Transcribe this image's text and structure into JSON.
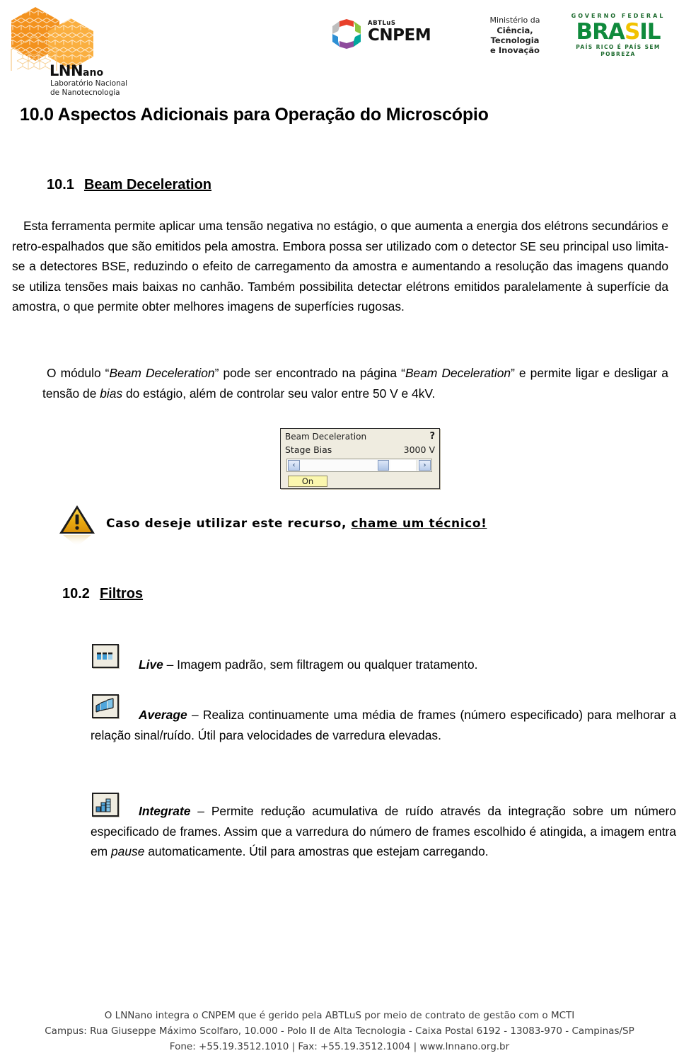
{
  "header": {
    "lnnano": {
      "word_main": "LNN",
      "word_small": "ano",
      "subtitle_line1": "Laboratório Nacional",
      "subtitle_line2": "de Nanotecnologia"
    },
    "cnpem": {
      "abtlus": "ABTLuS",
      "name": "CNPEM"
    },
    "ministerio": {
      "line1": "Ministério da",
      "line2": "Ciência, Tecnologia",
      "line3": "e Inovação"
    },
    "brasil": {
      "top": "GOVERNO FEDERAL",
      "wordmark": "BRASIL",
      "tagline": "PAÍS RICO É PAÍS SEM POBREZA"
    }
  },
  "document": {
    "title": "10.0 Aspectos Adicionais para Operação do Microscópio",
    "section_10_1": {
      "number": "10.1",
      "title": "Beam Deceleration",
      "paragraph_1_part1": "Esta ferramenta permite aplicar uma tensão negativa no estágio, o que aumenta a energia dos elétrons secundários e retro-espalhados que são emitidos pela amostra. Embora possa ser utilizado com o detector SE seu principal uso limita-se a detectores BSE, reduzindo o efeito de carregamento da amostra e aumentando a resolução das imagens quando se utiliza tensões mais baixas no canhão. Também possibilita detectar elétrons emitidos paralelamente à superfície da amostra, o que permite obter melhores imagens de superfícies rugosas.",
      "paragraph_2_a": "O módulo “",
      "paragraph_2_em1": "Beam Deceleration",
      "paragraph_2_b": "” pode ser encontrado na página “",
      "paragraph_2_em2": "Beam Deceleration",
      "paragraph_2_c": "” e permite ligar e desligar a tensão de ",
      "paragraph_2_em3": "bias",
      "paragraph_2_d": " do estágio, além de controlar seu valor entre 50 V e 4kV."
    },
    "beam_deceleration_widget": {
      "title": "Beam Deceleration",
      "help": "?",
      "field_label": "Stage Bias",
      "field_value": "3000 V",
      "left_arrow": "‹",
      "right_arrow": "›",
      "toggle_label": "On"
    },
    "warning": {
      "text_plain": "Caso deseje utilizar este recurso, ",
      "text_underlined": "chame um técnico!"
    },
    "section_10_2": {
      "number": "10.2",
      "title": "Filtros",
      "filters": [
        {
          "name": "Live",
          "icon": "live-frames-icon",
          "dash": " – ",
          "description": "Imagem padrão, sem filtragem ou qualquer tratamento."
        },
        {
          "name": "Average",
          "icon": "average-stacked-frames-icon",
          "dash": " – ",
          "description": "Realiza continuamente uma média de frames (número especificado) para melhorar a relação sinal/ruído. Útil para velocidades de varredura elevadas."
        },
        {
          "name": "Integrate",
          "icon": "integrate-bars-icon",
          "dash": " – ",
          "description_a": "Permite redução acumulativa de ruído através da integração sobre um número especificado de frames. Assim que a varredura do número de frames escolhido é atingida, a imagem entra em ",
          "description_em": "pause",
          "description_b": " automaticamente. Útil para amostras que estejam carregando."
        }
      ]
    }
  },
  "footer": {
    "line1": "O LNNano integra o CNPEM que é gerido pela ABTLuS por meio de contrato de gestão com o MCTI",
    "line2": "Campus: Rua Giuseppe Máximo Scolfaro, 10.000 - Polo II de Alta Tecnologia - Caixa Postal 6192 - 13083-970 - Campinas/SP",
    "line3": "Fone: +55.19.3512.1010 | Fax: +55.19.3512.1004 | www.lnnano.org.br"
  },
  "colors": {
    "hex_orange": "#F3921E",
    "hex_light_orange": "#FAAF40",
    "warning_yellow": "#E8A712",
    "brasil_green": "#0F8A3C",
    "brasil_yellow": "#F2C200",
    "widget_bg": "#EFECE0",
    "widget_button": "#FBF7AE"
  }
}
